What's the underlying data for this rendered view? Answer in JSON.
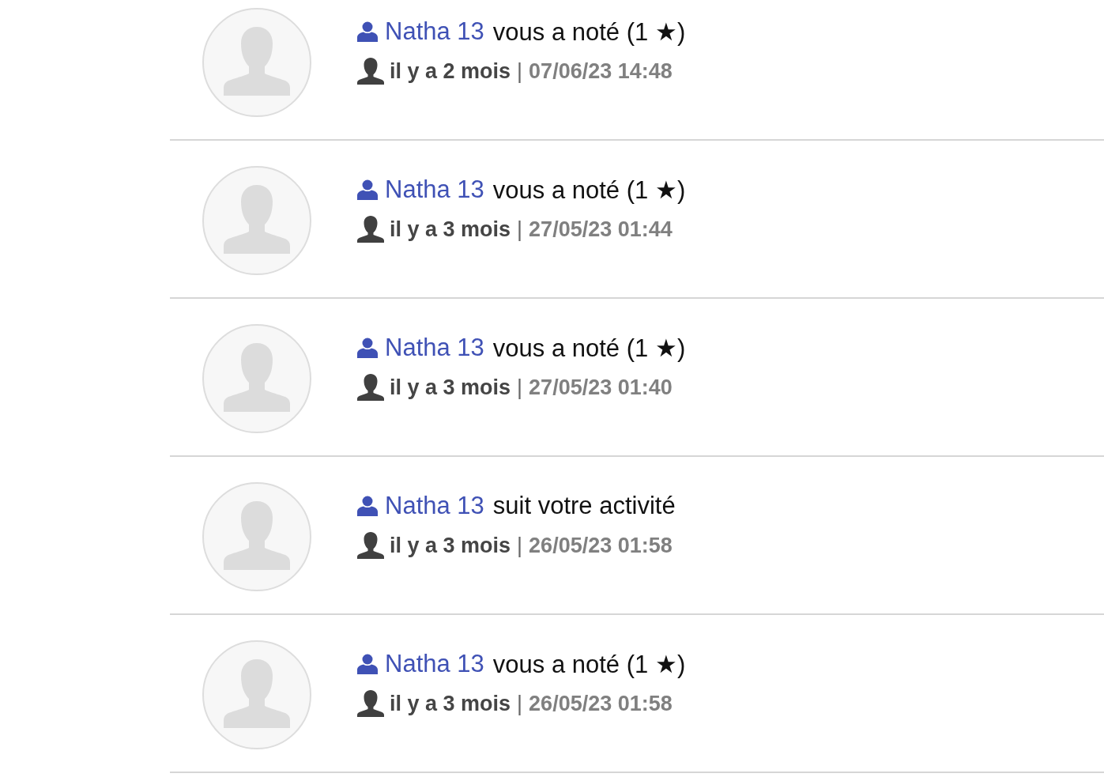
{
  "notifications": [
    {
      "user": "Natha 13",
      "action": "vous a noté (1 ★)",
      "relative_time": "il y a 2 mois",
      "separator": "|",
      "timestamp": "07/06/23 14:48"
    },
    {
      "user": "Natha 13",
      "action": "vous a noté (1 ★)",
      "relative_time": "il y a 3 mois",
      "separator": "|",
      "timestamp": "27/05/23 01:44"
    },
    {
      "user": "Natha 13",
      "action": "vous a noté (1 ★)",
      "relative_time": "il y a 3 mois",
      "separator": "|",
      "timestamp": "27/05/23 01:40"
    },
    {
      "user": "Natha 13",
      "action": "suit votre activité",
      "relative_time": "il y a 3 mois",
      "separator": "|",
      "timestamp": "26/05/23 01:58"
    },
    {
      "user": "Natha 13",
      "action": "vous a noté (1 ★)",
      "relative_time": "il y a 3 mois",
      "separator": "|",
      "timestamp": "26/05/23 01:58"
    }
  ]
}
